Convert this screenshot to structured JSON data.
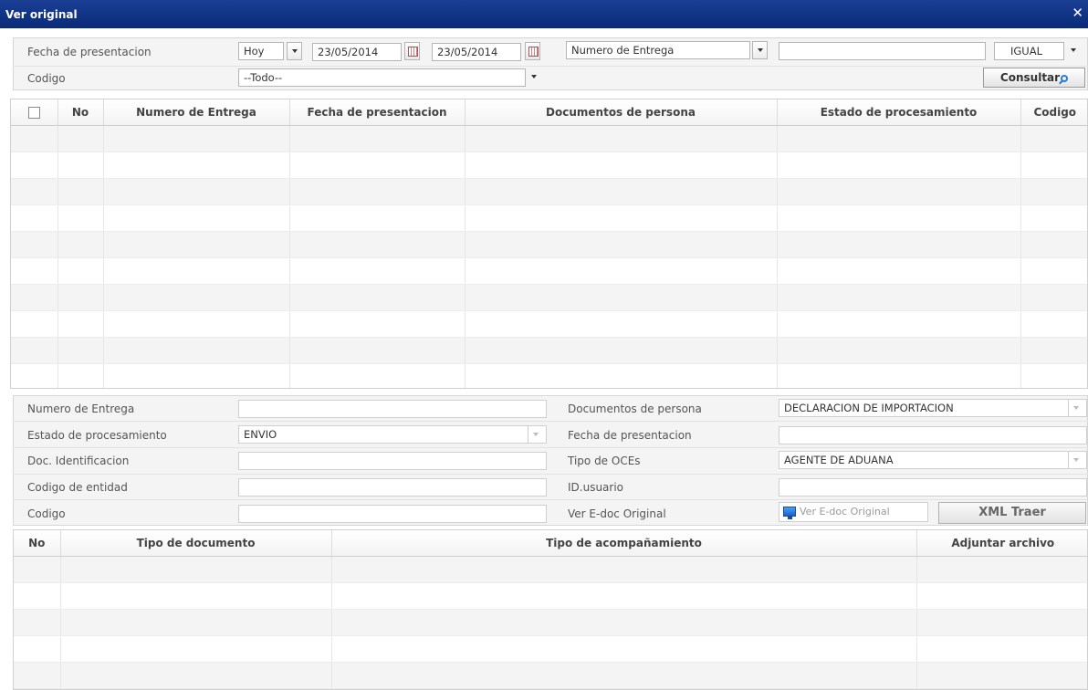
{
  "window": {
    "title": "Ver original",
    "close": "✕"
  },
  "filters": {
    "fecha_label": "Fecha de presentacion",
    "period_value": "Hoy",
    "date_from": "23/05/2014",
    "date_to": "23/05/2014",
    "field_select": "Numero de Entrega",
    "search_value": "",
    "operator_value": "IGUAL",
    "codigo_label": "Codigo",
    "codigo_value": "--Todo--",
    "consultar_label": "Consultar"
  },
  "grid": {
    "columns": [
      "No",
      "Numero de Entrega",
      "Fecha de presentacion",
      "Documentos de persona",
      "Estado de procesamiento",
      "Codigo"
    ],
    "rows": 10
  },
  "detail": {
    "numero_label": "Numero de Entrega",
    "numero_value": "",
    "estado_label": "Estado de procesamiento",
    "estado_value": "ENVIO",
    "doc_id_label": "Doc. Identificacion",
    "doc_id_value": "",
    "cod_entidad_label": "Codigo de entidad",
    "cod_entidad_value": "",
    "codigo_label": "Codigo",
    "codigo_value": "",
    "docs_persona_label": "Documentos de persona",
    "docs_persona_value": "DECLARACION DE IMPORTACION",
    "fecha_label": "Fecha de presentacion",
    "fecha_value": "",
    "tipo_oces_label": "Tipo de OCEs",
    "tipo_oces_value": "AGENTE DE ADUANA",
    "id_usuario_label": "ID.usuario",
    "id_usuario_value": "",
    "ver_edoc_label": "Ver E-doc Original",
    "ver_edoc_button": "Ver E-doc Original",
    "xml_button": "XML Traer"
  },
  "attachments": {
    "columns": [
      "No",
      "Tipo de documento",
      "Tipo de acompañamiento",
      "Adjuntar archivo"
    ],
    "rows": 5
  },
  "colors": {
    "titlebar": "#0f3185",
    "accent": "#2a7ad8"
  }
}
